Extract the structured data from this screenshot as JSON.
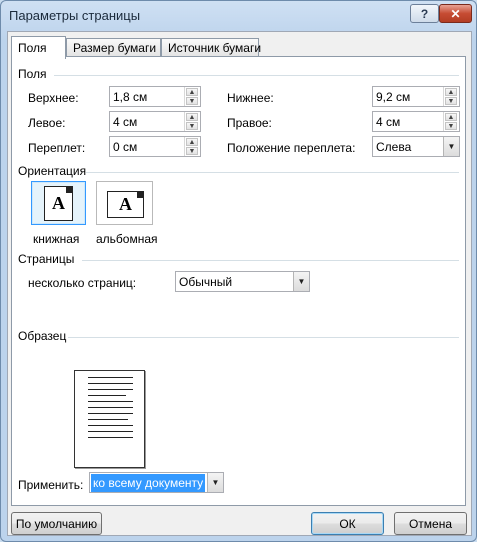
{
  "window": {
    "title": "Параметры страницы"
  },
  "tabs": [
    {
      "label": "Поля"
    },
    {
      "label": "Размер бумаги"
    },
    {
      "label": "Источник бумаги"
    }
  ],
  "margins": {
    "section": "Поля",
    "top_label": "Верхнее:",
    "top_value": "1,8 см",
    "bottom_label": "Нижнее:",
    "bottom_value": "9,2 см",
    "left_label": "Левое:",
    "left_value": "4 см",
    "right_label": "Правое:",
    "right_value": "4 см",
    "gutter_label": "Переплет:",
    "gutter_value": "0 см",
    "gutter_pos_label": "Положение переплета:",
    "gutter_pos_value": "Слева"
  },
  "orientation": {
    "section": "Ориентация",
    "portrait": "книжная",
    "landscape": "альбомная",
    "icon_letter": "A"
  },
  "pages": {
    "section": "Страницы",
    "multiple_label": "несколько страниц:",
    "multiple_value": "Обычный"
  },
  "preview": {
    "section": "Образец"
  },
  "apply": {
    "label": "Применить:",
    "value": "ко всему документу"
  },
  "buttons": {
    "default": "По умолчанию",
    "ok": "ОК",
    "cancel": "Отмена"
  },
  "icons": {
    "help": "?",
    "close": "✕",
    "up": "▲",
    "down": "▼",
    "dropdown": "▼"
  }
}
